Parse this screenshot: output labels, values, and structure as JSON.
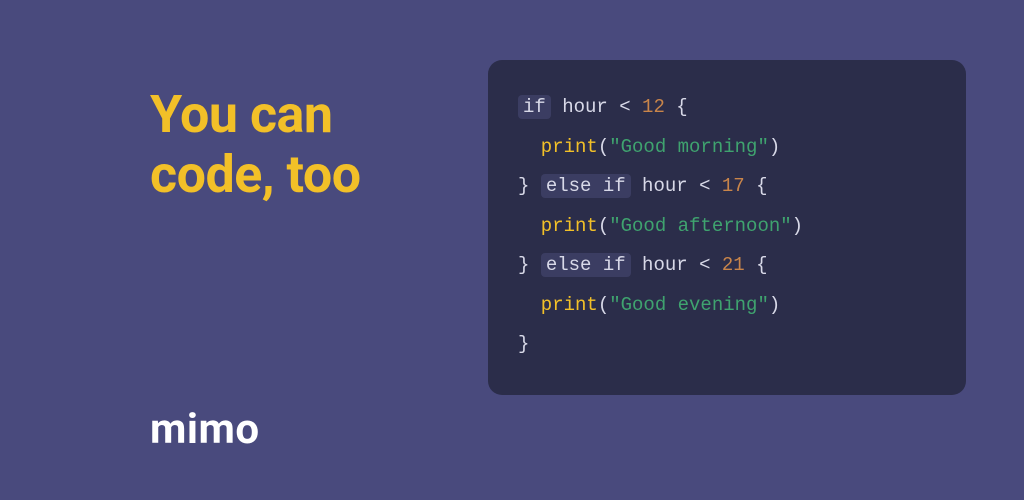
{
  "headline": "You can\ncode, too",
  "brand": "mimo",
  "code": {
    "lines": [
      {
        "kw": "if",
        "var": "hour",
        "op": "<",
        "num": "12",
        "brace_open": "{"
      },
      {
        "indent": true,
        "fn": "print",
        "paren_open": "(",
        "str": "\"Good morning\"",
        "paren_close": ")"
      },
      {
        "brace_close": "}",
        "kw": "else if",
        "var": "hour",
        "op": "<",
        "num": "17",
        "brace_open": "{"
      },
      {
        "indent": true,
        "fn": "print",
        "paren_open": "(",
        "str": "\"Good afternoon\"",
        "paren_close": ")"
      },
      {
        "brace_close": "}",
        "kw": "else if",
        "var": "hour",
        "op": "<",
        "num": "21",
        "brace_open": "{"
      },
      {
        "indent": true,
        "fn": "print",
        "paren_open": "(",
        "str": "\"Good evening\"",
        "paren_close": ")"
      },
      {
        "brace_close": "}"
      }
    ]
  }
}
